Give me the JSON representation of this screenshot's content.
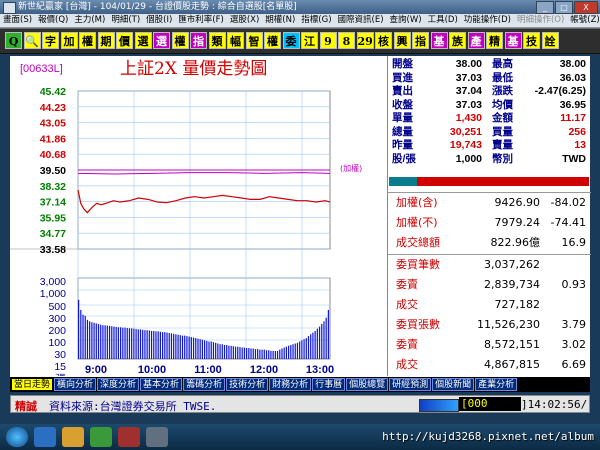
{
  "window": {
    "title": "新世紀贏家 [台灣] - 104/01/29 - 台證價股走勢 : 綜合自選股[名單股]",
    "btn_min": "_",
    "btn_max": "□",
    "btn_close": "X"
  },
  "menu": [
    "畫面(S)",
    "報價(Q)",
    "主力(M)",
    "明細(T)",
    "個股(I)",
    "匯市利率(F)",
    "選股(X)",
    "期權(N)",
    "指標(G)",
    "國際資訊(E)",
    "查詢(W)",
    "工具(D)",
    "功能操作(D)",
    "明細操作(O)",
    "帳號(Z)",
    "說明(H)",
    "視窗(Y)"
  ],
  "menu_dim_index": 13,
  "toolbar": [
    {
      "t": "Q",
      "bg": "#2fae2f",
      "fg": "#000000"
    },
    {
      "t": "🔍",
      "bg": "#ffff00",
      "fg": "#000000"
    },
    {
      "t": "字",
      "bg": "#ffff00",
      "fg": "#000000"
    },
    {
      "t": "加",
      "bg": "#ffff00",
      "fg": "#000000"
    },
    {
      "t": "權",
      "bg": "#ffff00",
      "fg": "#000000"
    },
    {
      "t": "期",
      "bg": "#ffff00",
      "fg": "#000000"
    },
    {
      "t": "價",
      "bg": "#ffff00",
      "fg": "#000000"
    },
    {
      "t": "選",
      "bg": "#ffff00",
      "fg": "#000000"
    },
    {
      "t": "選",
      "bg": "#c000c0",
      "fg": "#ffffff"
    },
    {
      "t": "權",
      "bg": "#ffff00",
      "fg": "#000000"
    },
    {
      "t": "指",
      "bg": "#c000c0",
      "fg": "#ffffff"
    },
    {
      "t": "類",
      "bg": "#ffff00",
      "fg": "#000000"
    },
    {
      "t": "幅",
      "bg": "#ffff00",
      "fg": "#000000"
    },
    {
      "t": "智",
      "bg": "#ffff00",
      "fg": "#000000"
    },
    {
      "t": "權",
      "bg": "#ffff00",
      "fg": "#000000"
    },
    {
      "t": "委",
      "bg": "#00c0ff",
      "fg": "#000000"
    },
    {
      "t": "江",
      "bg": "#ffff00",
      "fg": "#000000"
    },
    {
      "t": "9",
      "bg": "#ffff00",
      "fg": "#000000"
    },
    {
      "t": "8",
      "bg": "#ffff00",
      "fg": "#000000"
    },
    {
      "t": "29",
      "bg": "#ffff00",
      "fg": "#000000"
    },
    {
      "t": "核",
      "bg": "#ffff00",
      "fg": "#000000"
    },
    {
      "t": "興",
      "bg": "#ffff00",
      "fg": "#000000"
    },
    {
      "t": "指",
      "bg": "#ffff00",
      "fg": "#000000"
    },
    {
      "t": "基",
      "bg": "#c000c0",
      "fg": "#ffffff"
    },
    {
      "t": "族",
      "bg": "#ffff00",
      "fg": "#000000"
    },
    {
      "t": "產",
      "bg": "#c000c0",
      "fg": "#ffffff"
    },
    {
      "t": "精",
      "bg": "#ffff00",
      "fg": "#000000"
    },
    {
      "t": "基",
      "bg": "#c000c0",
      "fg": "#ffffff"
    },
    {
      "t": "技",
      "bg": "#ffff00",
      "fg": "#000000"
    },
    {
      "t": "詮",
      "bg": "#ffff00",
      "fg": "#000000"
    }
  ],
  "stock": {
    "code": "[00633L]",
    "name": "上証2X  量價走勢圖"
  },
  "quote": [
    {
      "l1": "開盤",
      "v1": "38.00",
      "c1": "blk",
      "l2": "最高",
      "v2": "38.00",
      "c2": "blk"
    },
    {
      "l1": "買進",
      "v1": "37.03",
      "c1": "blk",
      "l2": "最低",
      "v2": "36.03",
      "c2": "blk"
    },
    {
      "l1": "賣出",
      "v1": "37.04",
      "c1": "blk",
      "l2": "漲跌",
      "v2": "-2.47(6.25)",
      "c2": "blk"
    },
    {
      "l1": "收盤",
      "v1": "37.03",
      "c1": "blk",
      "l2": "均價",
      "v2": "36.95",
      "c2": "blk"
    },
    {
      "l1": "單量",
      "v1": "1,430",
      "c1": "red",
      "l2": "金額",
      "v2": "11.17",
      "c2": "red"
    },
    {
      "l1": "總量",
      "v1": "30,251",
      "c1": "red",
      "l2": "買量",
      "v2": "256",
      "c2": "red"
    },
    {
      "l1": "昨量",
      "v1": "19,743",
      "c1": "red",
      "l2": "賣量",
      "v2": "13",
      "c2": "red"
    },
    {
      "l1": "股/張",
      "v1": "1,000",
      "c1": "blk",
      "l2": "幣別",
      "v2": "TWD",
      "c2": "blk"
    }
  ],
  "index": [
    {
      "label": "加權(含)",
      "value": "9426.90",
      "chg": "-84.02"
    },
    {
      "label": "加權(不)",
      "value": "7979.24",
      "chg": "-74.41"
    },
    {
      "label": "成交總額",
      "value": "822.96億",
      "chg": "16.9"
    }
  ],
  "orders": [
    {
      "label": "委買筆數",
      "value": "3,037,262",
      "extra": ""
    },
    {
      "label": "委賣",
      "value": "2,839,734",
      "extra": "0.93"
    },
    {
      "label": "成交",
      "value": "727,182",
      "extra": ""
    },
    {
      "label": "委買張數",
      "value": "11,526,230",
      "extra": "3.79"
    },
    {
      "label": "委賣",
      "value": "8,572,151",
      "extra": "3.02"
    },
    {
      "label": "成交",
      "value": "4,867,815",
      "extra": "6.69"
    }
  ],
  "tabs": [
    {
      "label": "當日走勢",
      "active": true
    },
    {
      "label": "橫向分析",
      "active": false
    },
    {
      "label": "深度分析",
      "active": false
    },
    {
      "label": "基本分析",
      "active": false
    },
    {
      "label": "籌碼分析",
      "active": false
    },
    {
      "label": "技術分析",
      "active": false
    },
    {
      "label": "財務分析",
      "active": false
    },
    {
      "label": "行事曆",
      "active": false
    },
    {
      "label": "個股總覽",
      "active": false
    },
    {
      "label": "研經預測",
      "active": false
    },
    {
      "label": "個股新聞",
      "active": false
    },
    {
      "label": "產業分析",
      "active": false
    }
  ],
  "status": {
    "left": "精誠",
    "source": "資料來源:台灣證券交易所 TWSE.",
    "input": "[000",
    "clock": "]14:02:56/"
  },
  "taskbar_url": "http://kujd3268.pixnet.net/album",
  "chart_data": {
    "type": "line",
    "x_ticks": [
      "9:00",
      "10:00",
      "11:00",
      "12:00",
      "13:00"
    ],
    "y_ticks": [
      "45.42",
      "44.23",
      "43.05",
      "41.86",
      "40.68",
      "39.50",
      "38.32",
      "37.14",
      "35.95",
      "34.77",
      "33.58"
    ],
    "y_colors": [
      "#008000",
      "#d00000",
      "#d00000",
      "#d00000",
      "#d00000",
      "#000000",
      "#008000",
      "#008000",
      "#008000",
      "#008000",
      "#000000"
    ],
    "ylim": [
      33.58,
      45.42
    ],
    "ref_price": 39.5,
    "ref_label": "(加權)",
    "x_minutes": [
      0,
      270
    ],
    "price": [
      [
        0,
        38.0
      ],
      [
        3,
        37.0
      ],
      [
        6,
        36.6
      ],
      [
        10,
        36.3
      ],
      [
        15,
        36.7
      ],
      [
        20,
        37.0
      ],
      [
        25,
        36.9
      ],
      [
        30,
        37.0
      ],
      [
        38,
        37.2
      ],
      [
        45,
        37.1
      ],
      [
        55,
        37.2
      ],
      [
        65,
        37.4
      ],
      [
        75,
        37.3
      ],
      [
        85,
        37.1
      ],
      [
        95,
        37.05
      ],
      [
        105,
        37.2
      ],
      [
        115,
        37.4
      ],
      [
        125,
        37.5
      ],
      [
        135,
        37.4
      ],
      [
        145,
        37.5
      ],
      [
        155,
        37.6
      ],
      [
        165,
        37.5
      ],
      [
        175,
        37.4
      ],
      [
        185,
        37.3
      ],
      [
        195,
        37.3
      ],
      [
        205,
        37.5
      ],
      [
        215,
        37.4
      ],
      [
        225,
        37.3
      ],
      [
        235,
        37.2
      ],
      [
        245,
        37.2
      ],
      [
        255,
        37.1
      ],
      [
        265,
        37.2
      ],
      [
        270,
        37.1
      ]
    ],
    "index_line": [
      [
        0,
        39.25
      ],
      [
        40,
        39.2
      ],
      [
        80,
        39.25
      ],
      [
        120,
        39.3
      ],
      [
        160,
        39.3
      ],
      [
        200,
        39.25
      ],
      [
        240,
        39.3
      ],
      [
        270,
        39.25
      ]
    ],
    "vol_ticks": [
      "3,000",
      "1,000",
      "500",
      "300",
      "200",
      "100",
      "30",
      "15",
      "張"
    ],
    "vol_ylim": [
      0,
      3000
    ],
    "volume": [
      1600,
      1100,
      900,
      850,
      700,
      650,
      620,
      600,
      580,
      560,
      540,
      520,
      520,
      510,
      500,
      490,
      480,
      470,
      460,
      460,
      450,
      450,
      440,
      430,
      430,
      420,
      410,
      400,
      400,
      390,
      380,
      380,
      370,
      360,
      360,
      350,
      350,
      340,
      330,
      330,
      320,
      310,
      300,
      290,
      280,
      270,
      260,
      250,
      250,
      240,
      230,
      220,
      210,
      200,
      190,
      180,
      170,
      160,
      150,
      140,
      140,
      130,
      120,
      110,
      100,
      100,
      90,
      90,
      80,
      80,
      75,
      70,
      70,
      65,
      60,
      60,
      55,
      55,
      50,
      50,
      45,
      45,
      40,
      40,
      40,
      35,
      35,
      30,
      30,
      30,
      30,
      40,
      50,
      60,
      70,
      80,
      90,
      100,
      110,
      120,
      140,
      160,
      180,
      200,
      240,
      280,
      320,
      360,
      420,
      480,
      560,
      650,
      780,
      1100
    ]
  }
}
